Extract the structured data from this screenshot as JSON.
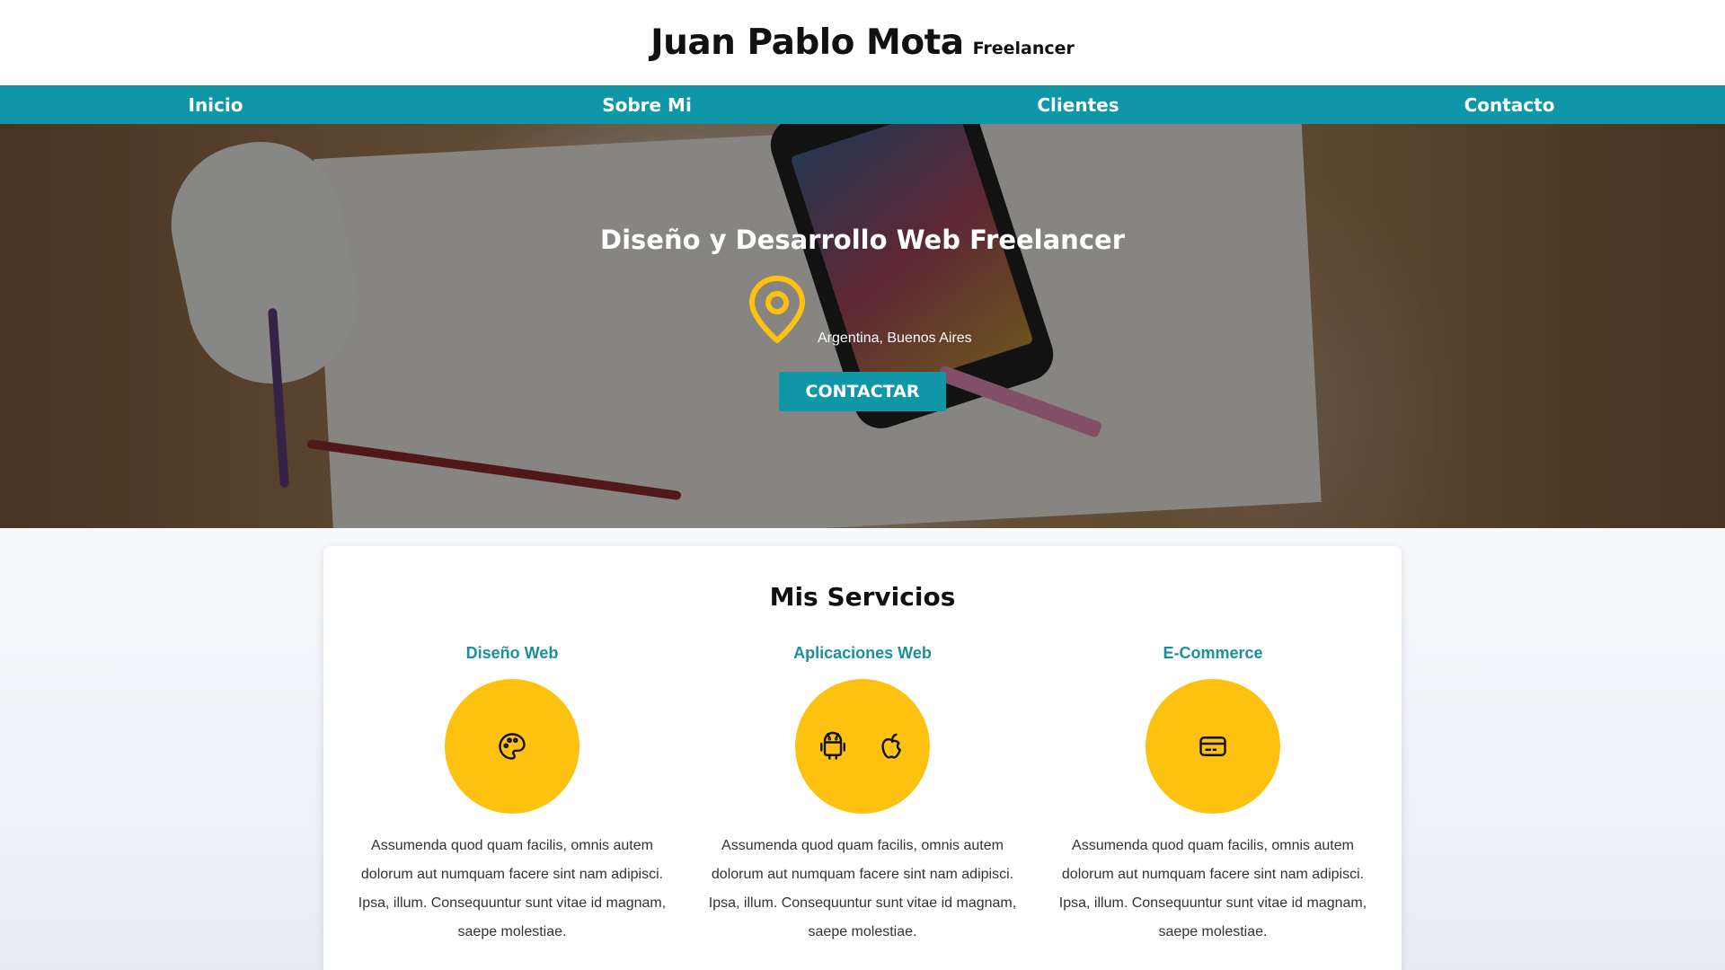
{
  "header": {
    "name": "Juan Pablo Mota",
    "tagline": "Freelancer"
  },
  "nav": {
    "items": [
      "Inicio",
      "Sobre Mi",
      "Clientes",
      "Contacto"
    ]
  },
  "hero": {
    "title": "Diseño y Desarrollo Web Freelancer",
    "location": "Argentina, Buenos Aires",
    "location_icon": "map-pin-icon",
    "cta_label": "CONTACTAR"
  },
  "services": {
    "title": "Mis Servicios",
    "items": [
      {
        "title": "Diseño Web",
        "icons": [
          "palette-icon"
        ],
        "description": "Assumenda quod quam facilis, omnis autem dolorum aut numquam facere sint nam adipisci. Ipsa, illum. Consequuntur sunt vitae id magnam, saepe molestiae."
      },
      {
        "title": "Aplicaciones Web",
        "icons": [
          "android-icon",
          "apple-icon"
        ],
        "description": "Assumenda quod quam facilis, omnis autem dolorum aut numquam facere sint nam adipisci. Ipsa, illum. Consequuntur sunt vitae id magnam, saepe molestiae."
      },
      {
        "title": "E-Commerce",
        "icons": [
          "credit-card-icon"
        ],
        "description": "Assumenda quod quam facilis, omnis autem dolorum aut numquam facere sint nam adipisci. Ipsa, illum. Consequuntur sunt vitae id magnam, saepe molestiae."
      }
    ]
  },
  "colors": {
    "primary": "#0f97a8",
    "accent": "#fdc20f",
    "service_title": "#1a8fa0"
  }
}
